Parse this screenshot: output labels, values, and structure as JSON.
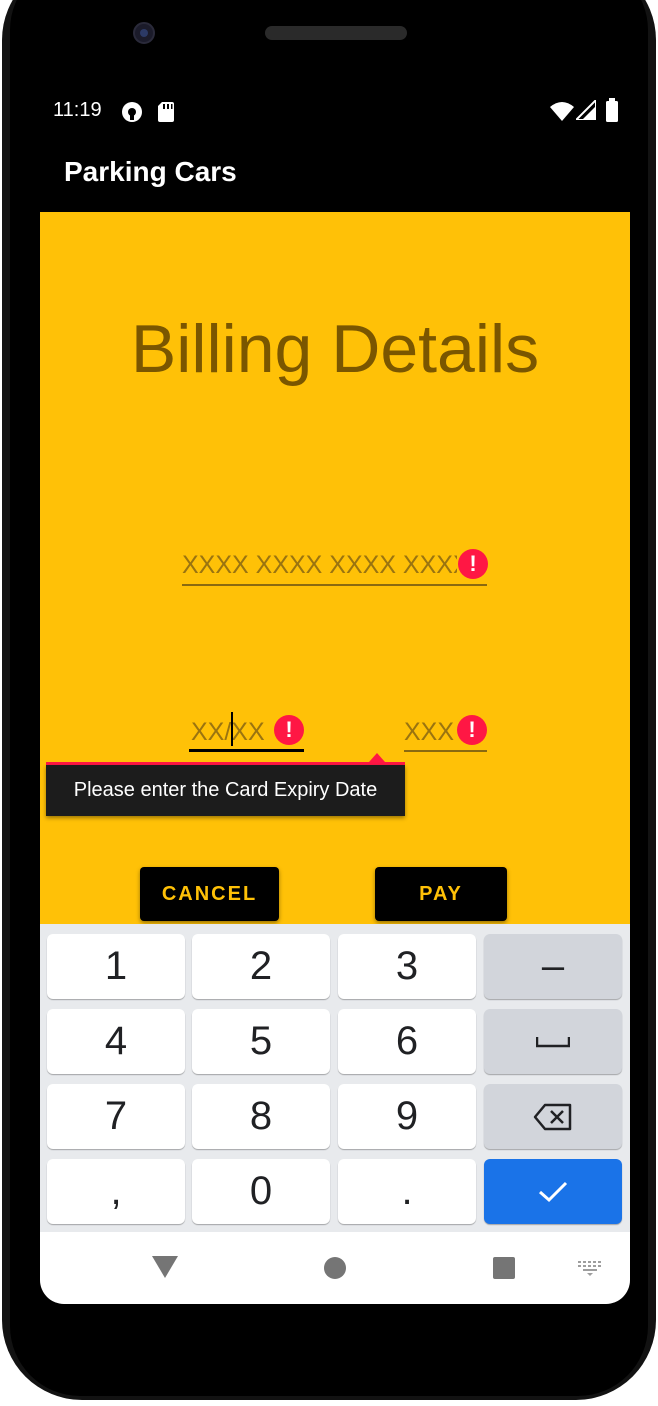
{
  "status_bar": {
    "time": "11:19"
  },
  "app_bar": {
    "title": "Parking Cars"
  },
  "form": {
    "heading": "Billing Details",
    "card_number": {
      "placeholder": "XXXX XXXX XXXX XXXX"
    },
    "expiry": {
      "placeholder": "XX/XX"
    },
    "cvv": {
      "placeholder": "XXX"
    },
    "error_icon": "!",
    "expiry_error": "Please enter the Card Expiry Date",
    "cancel_label": "CANCEL",
    "pay_label": "PAY"
  },
  "keyboard": {
    "rows": [
      [
        "1",
        "2",
        "3",
        "–"
      ],
      [
        "4",
        "5",
        "6",
        "space"
      ],
      [
        "7",
        "8",
        "9",
        "backspace"
      ],
      [
        ",",
        "0",
        ".",
        "done"
      ]
    ]
  },
  "colors": {
    "background": "#FFC107",
    "heading": "#7A5600",
    "error": "#FF1744",
    "button_bg": "#000000",
    "button_text": "#FFC107",
    "keyboard_action": "#1A73E8"
  },
  "icons": [
    "hotspot-icon",
    "sd-card-icon",
    "wifi-icon",
    "signal-icon",
    "battery-icon",
    "error-icon",
    "space-icon",
    "backspace-icon",
    "check-icon",
    "back-icon",
    "home-icon",
    "recents-icon",
    "keyboard-icon"
  ]
}
